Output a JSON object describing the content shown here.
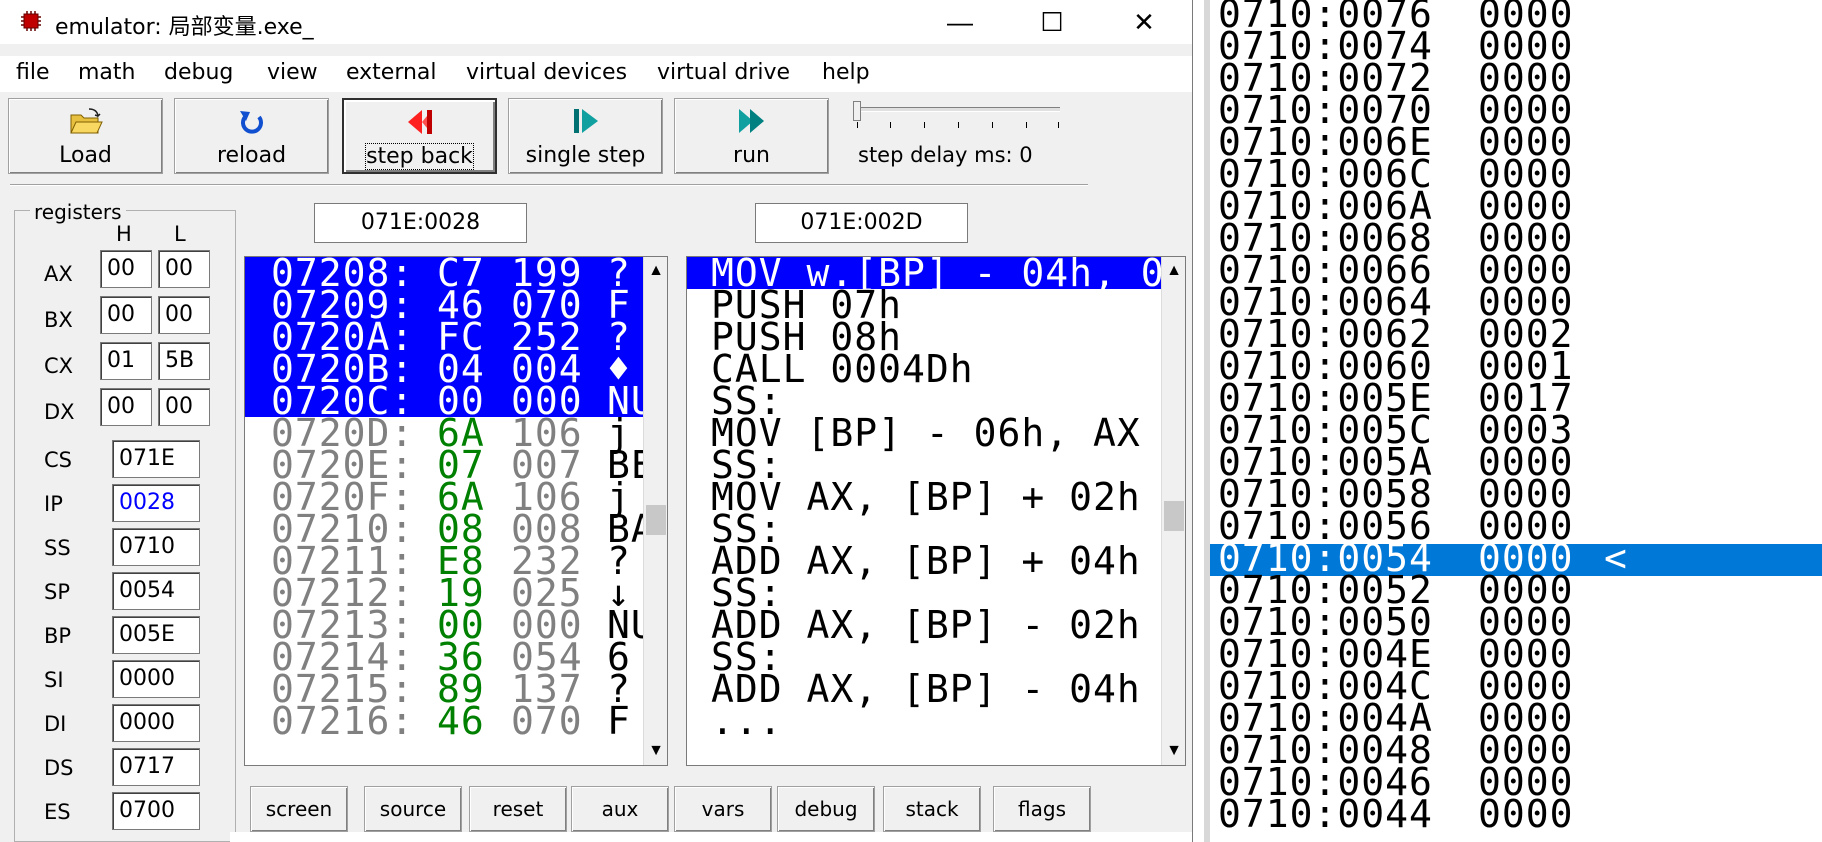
{
  "window": {
    "title": "emulator: 局部变量.exe_",
    "controls": {
      "minimize": "—",
      "maximize": "☐",
      "close": "✕"
    }
  },
  "menu": [
    "file",
    "math",
    "debug",
    "view",
    "external",
    "virtual devices",
    "virtual drive",
    "help"
  ],
  "toolbar": {
    "load": "Load",
    "reload": "reload",
    "step_back": "step back",
    "single_step": "single step",
    "run": "run",
    "step_delay_label": "step delay ms: 0"
  },
  "registers": {
    "group_label": "registers",
    "col_h": "H",
    "col_l": "L",
    "split": [
      {
        "name": "AX",
        "h": "00",
        "l": "00"
      },
      {
        "name": "BX",
        "h": "00",
        "l": "00"
      },
      {
        "name": "CX",
        "h": "01",
        "l": "5B"
      },
      {
        "name": "DX",
        "h": "00",
        "l": "00"
      }
    ],
    "full": [
      {
        "name": "CS",
        "value": "071E"
      },
      {
        "name": "IP",
        "value": "0028"
      },
      {
        "name": "SS",
        "value": "0710"
      },
      {
        "name": "SP",
        "value": "0054"
      },
      {
        "name": "BP",
        "value": "005E"
      },
      {
        "name": "SI",
        "value": "0000"
      },
      {
        "name": "DI",
        "value": "0000"
      },
      {
        "name": "DS",
        "value": "0717"
      },
      {
        "name": "ES",
        "value": "0700"
      }
    ]
  },
  "address_fields": {
    "memory": "071E:0028",
    "disassembly": "071E:002D"
  },
  "memory": [
    {
      "addr": "07208:",
      "hex": "C7",
      "dec": "199",
      "ch": "?",
      "selected": true
    },
    {
      "addr": "07209:",
      "hex": "46",
      "dec": "070",
      "ch": "F",
      "selected": true
    },
    {
      "addr": "0720A:",
      "hex": "FC",
      "dec": "252",
      "ch": "?",
      "selected": true
    },
    {
      "addr": "0720B:",
      "hex": "04",
      "dec": "004",
      "ch": "♦",
      "selected": true
    },
    {
      "addr": "0720C:",
      "hex": "00",
      "dec": "000",
      "ch": "NU",
      "selected": true
    },
    {
      "addr": "0720D:",
      "hex": "6A",
      "dec": "106",
      "ch": "j",
      "selected": false
    },
    {
      "addr": "0720E:",
      "hex": "07",
      "dec": "007",
      "ch": "BE",
      "selected": false
    },
    {
      "addr": "0720F:",
      "hex": "6A",
      "dec": "106",
      "ch": "j",
      "selected": false
    },
    {
      "addr": "07210:",
      "hex": "08",
      "dec": "008",
      "ch": "BA",
      "selected": false
    },
    {
      "addr": "07211:",
      "hex": "E8",
      "dec": "232",
      "ch": "?",
      "selected": false
    },
    {
      "addr": "07212:",
      "hex": "19",
      "dec": "025",
      "ch": "↓",
      "selected": false
    },
    {
      "addr": "07213:",
      "hex": "00",
      "dec": "000",
      "ch": "NU",
      "selected": false
    },
    {
      "addr": "07214:",
      "hex": "36",
      "dec": "054",
      "ch": "6",
      "selected": false
    },
    {
      "addr": "07215:",
      "hex": "89",
      "dec": "137",
      "ch": "?",
      "selected": false
    },
    {
      "addr": "07216:",
      "hex": "46",
      "dec": "070",
      "ch": "F",
      "selected": false
    }
  ],
  "disassembly": [
    {
      "text": "MOV w.[BP] - 04h, 0",
      "selected": true
    },
    {
      "text": "PUSH 07h",
      "selected": false
    },
    {
      "text": "PUSH 08h",
      "selected": false
    },
    {
      "text": "CALL 0004Dh",
      "selected": false
    },
    {
      "text": "SS:",
      "selected": false
    },
    {
      "text": "MOV [BP] - 06h, AX",
      "selected": false
    },
    {
      "text": "SS:",
      "selected": false
    },
    {
      "text": "MOV AX, [BP] + 02h",
      "selected": false
    },
    {
      "text": "SS:",
      "selected": false
    },
    {
      "text": "ADD AX, [BP] + 04h",
      "selected": false
    },
    {
      "text": "SS:",
      "selected": false
    },
    {
      "text": "ADD AX, [BP] - 02h",
      "selected": false
    },
    {
      "text": "SS:",
      "selected": false
    },
    {
      "text": "ADD AX, [BP] - 04h",
      "selected": false
    },
    {
      "text": "...",
      "selected": false
    }
  ],
  "bottom_buttons": [
    "screen",
    "source",
    "reset",
    "aux",
    "vars",
    "debug",
    "stack",
    "flags"
  ],
  "stack": [
    {
      "addr": "0710:0076",
      "value": "0000",
      "marker": ""
    },
    {
      "addr": "0710:0074",
      "value": "0000",
      "marker": ""
    },
    {
      "addr": "0710:0072",
      "value": "0000",
      "marker": ""
    },
    {
      "addr": "0710:0070",
      "value": "0000",
      "marker": ""
    },
    {
      "addr": "0710:006E",
      "value": "0000",
      "marker": ""
    },
    {
      "addr": "0710:006C",
      "value": "0000",
      "marker": ""
    },
    {
      "addr": "0710:006A",
      "value": "0000",
      "marker": ""
    },
    {
      "addr": "0710:0068",
      "value": "0000",
      "marker": ""
    },
    {
      "addr": "0710:0066",
      "value": "0000",
      "marker": ""
    },
    {
      "addr": "0710:0064",
      "value": "0000",
      "marker": ""
    },
    {
      "addr": "0710:0062",
      "value": "0002",
      "marker": ""
    },
    {
      "addr": "0710:0060",
      "value": "0001",
      "marker": ""
    },
    {
      "addr": "0710:005E",
      "value": "0017",
      "marker": ""
    },
    {
      "addr": "0710:005C",
      "value": "0003",
      "marker": ""
    },
    {
      "addr": "0710:005A",
      "value": "0000",
      "marker": ""
    },
    {
      "addr": "0710:0058",
      "value": "0000",
      "marker": ""
    },
    {
      "addr": "0710:0056",
      "value": "0000",
      "marker": ""
    },
    {
      "addr": "0710:0054",
      "value": "0000",
      "marker": "<",
      "selected": true
    },
    {
      "addr": "0710:0052",
      "value": "0000",
      "marker": ""
    },
    {
      "addr": "0710:0050",
      "value": "0000",
      "marker": ""
    },
    {
      "addr": "0710:004E",
      "value": "0000",
      "marker": ""
    },
    {
      "addr": "0710:004C",
      "value": "0000",
      "marker": ""
    },
    {
      "addr": "0710:004A",
      "value": "0000",
      "marker": ""
    },
    {
      "addr": "0710:0048",
      "value": "0000",
      "marker": ""
    },
    {
      "addr": "0710:0046",
      "value": "0000",
      "marker": ""
    },
    {
      "addr": "0710:0044",
      "value": "0000",
      "marker": ""
    }
  ],
  "colors": {
    "selection_blue": "#0000ff",
    "stack_selection": "#0078d7",
    "hex_green": "#008000",
    "grey_text": "#808080",
    "ip_blue": "#0000ff"
  }
}
